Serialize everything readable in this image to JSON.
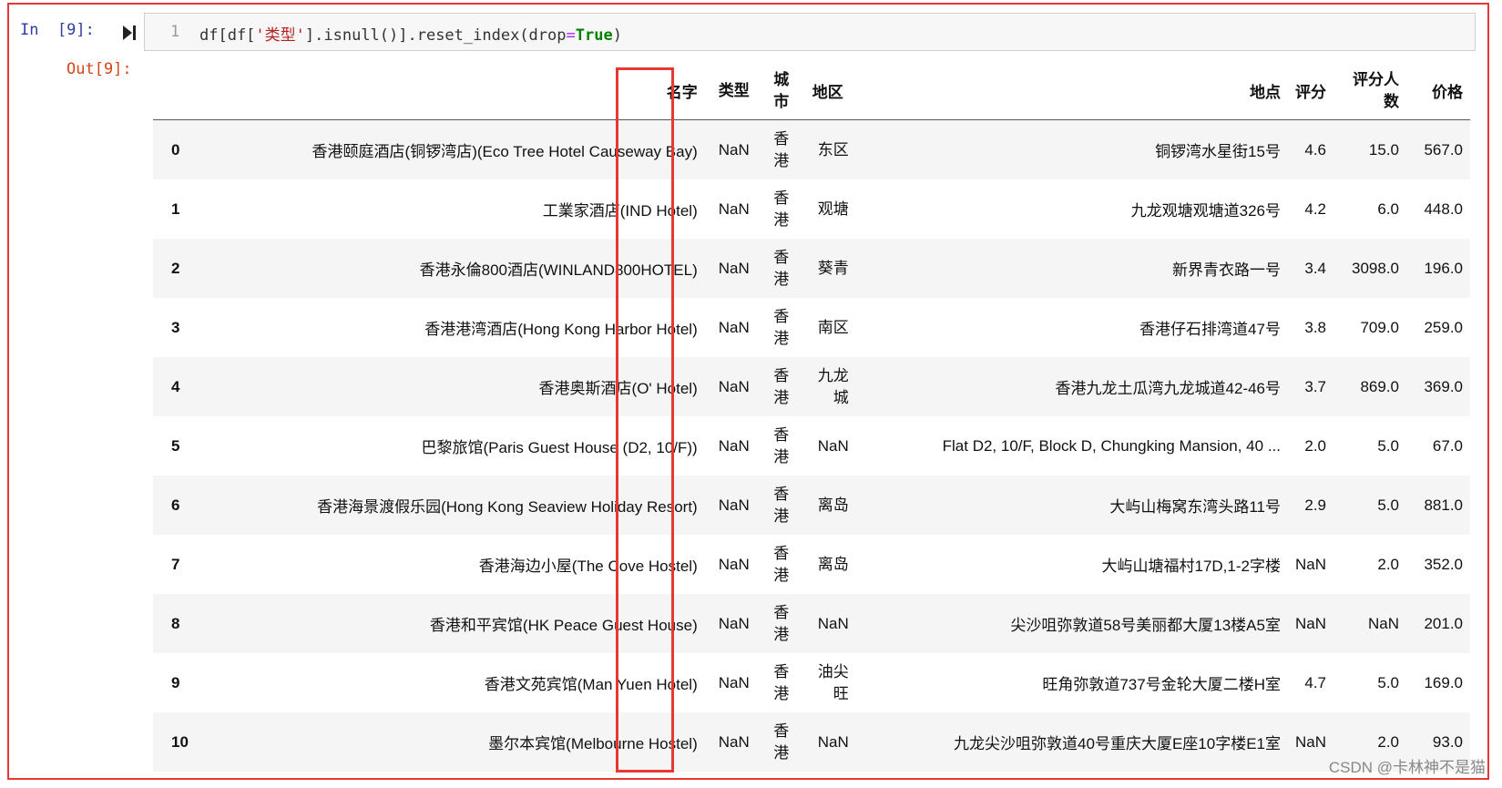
{
  "input_prompt": "In  [9]:",
  "output_prompt": "Out[9]:",
  "code": {
    "line_number": "1",
    "part1": "df[df[",
    "string": "'类型'",
    "part2": "].isnull()].reset_index(drop",
    "equals": "=",
    "keyword": "True",
    "part3": ")"
  },
  "table": {
    "columns": [
      "名字",
      "类型",
      "城市",
      "地区",
      "地点",
      "评分",
      "评分人数",
      "价格"
    ],
    "rows": [
      {
        "idx": "0",
        "name": "香港颐庭酒店(铜锣湾店)(Eco Tree Hotel Causeway Bay)",
        "type": "NaN",
        "city": "香港",
        "district": "东区",
        "address": "铜锣湾水星街15号",
        "rating": "4.6",
        "raters": "15.0",
        "price": "567.0"
      },
      {
        "idx": "1",
        "name": "工業家酒店(IND Hotel)",
        "type": "NaN",
        "city": "香港",
        "district": "观塘",
        "address": "九龙观塘观塘道326号",
        "rating": "4.2",
        "raters": "6.0",
        "price": "448.0"
      },
      {
        "idx": "2",
        "name": "香港永倫800酒店(WINLAND800HOTEL)",
        "type": "NaN",
        "city": "香港",
        "district": "葵青",
        "address": "新界青衣路一号",
        "rating": "3.4",
        "raters": "3098.0",
        "price": "196.0"
      },
      {
        "idx": "3",
        "name": "香港港湾酒店(Hong Kong Harbor Hotel)",
        "type": "NaN",
        "city": "香港",
        "district": "南区",
        "address": "香港仔石排湾道47号",
        "rating": "3.8",
        "raters": "709.0",
        "price": "259.0"
      },
      {
        "idx": "4",
        "name": "香港奥斯酒店(O' Hotel)",
        "type": "NaN",
        "city": "香港",
        "district": "九龙城",
        "address": "香港九龙土瓜湾九龙城道42-46号",
        "rating": "3.7",
        "raters": "869.0",
        "price": "369.0"
      },
      {
        "idx": "5",
        "name": "巴黎旅馆(Paris Guest House (D2, 10/F))",
        "type": "NaN",
        "city": "香港",
        "district": "NaN",
        "address": "Flat D2, 10/F, Block D, Chungking Mansion, 40 ...",
        "rating": "2.0",
        "raters": "5.0",
        "price": "67.0"
      },
      {
        "idx": "6",
        "name": "香港海景渡假乐园(Hong Kong Seaview Holiday Resort)",
        "type": "NaN",
        "city": "香港",
        "district": "离岛",
        "address": "大屿山梅窝东湾头路11号",
        "rating": "2.9",
        "raters": "5.0",
        "price": "881.0"
      },
      {
        "idx": "7",
        "name": "香港海边小屋(The Cove Hostel)",
        "type": "NaN",
        "city": "香港",
        "district": "离岛",
        "address": "大屿山塘福村17D,1-2字楼",
        "rating": "NaN",
        "raters": "2.0",
        "price": "352.0"
      },
      {
        "idx": "8",
        "name": "香港和平宾馆(HK Peace Guest House)",
        "type": "NaN",
        "city": "香港",
        "district": "NaN",
        "address": "尖沙咀弥敦道58号美丽都大厦13楼A5室",
        "rating": "NaN",
        "raters": "NaN",
        "price": "201.0"
      },
      {
        "idx": "9",
        "name": "香港文苑宾馆(Man Yuen Hotel)",
        "type": "NaN",
        "city": "香港",
        "district": "油尖旺",
        "address": "旺角弥敦道737号金轮大厦二楼H室",
        "rating": "4.7",
        "raters": "5.0",
        "price": "169.0"
      },
      {
        "idx": "10",
        "name": "墨尔本宾馆(Melbourne Hostel)",
        "type": "NaN",
        "city": "香港",
        "district": "NaN",
        "address": "九龙尖沙咀弥敦道40号重庆大厦E座10字楼E1室",
        "rating": "NaN",
        "raters": "2.0",
        "price": "93.0"
      }
    ]
  },
  "watermark": "CSDN @卡林神不是猫",
  "colors": {
    "highlight": "#e53935",
    "in_prompt": "#303f9f",
    "out_prompt": "#d84315"
  }
}
